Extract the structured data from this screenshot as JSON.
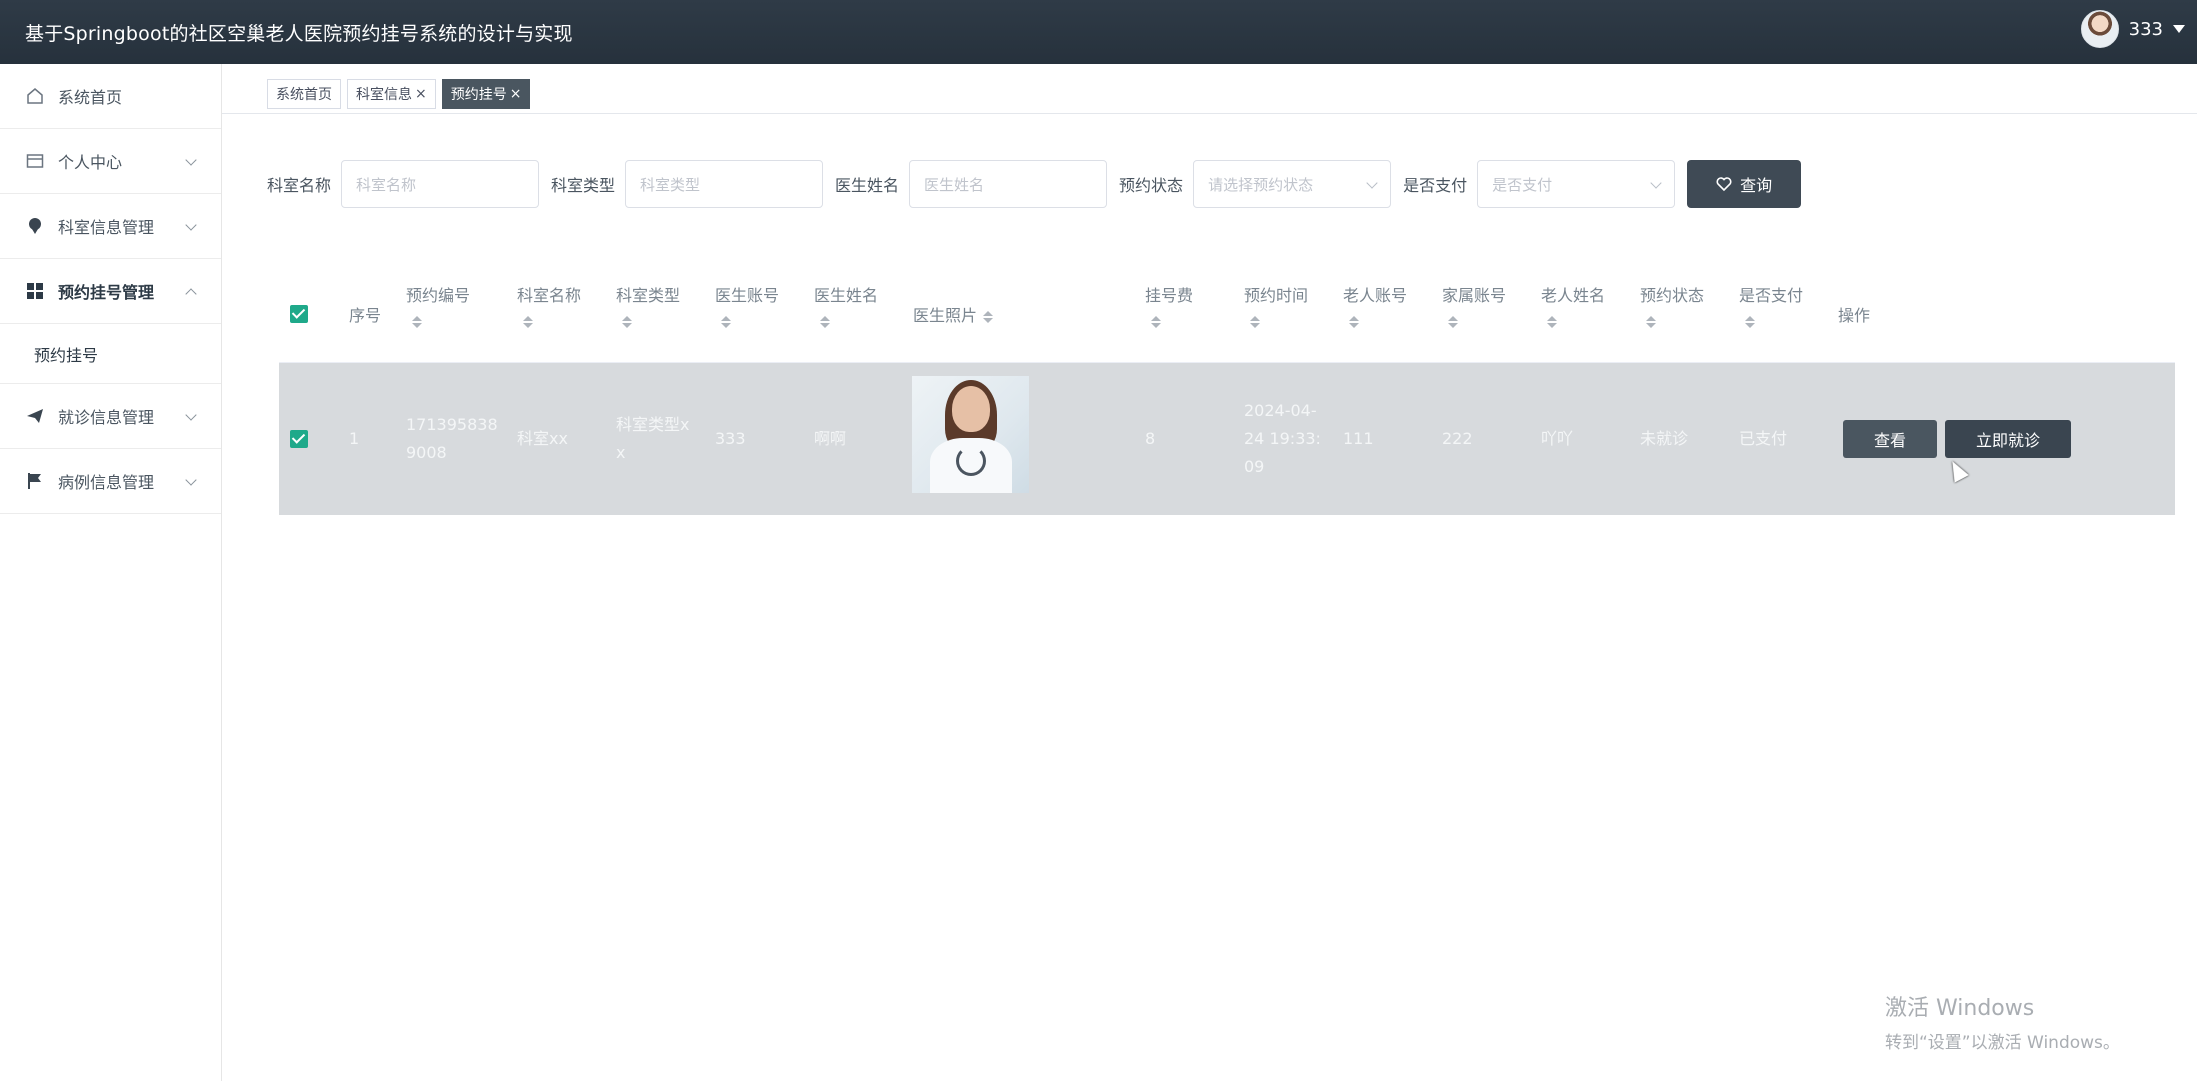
{
  "header": {
    "title": "基于Springboot的社区空巢老人医院预约挂号系统的设计与实现",
    "user_name": "333"
  },
  "sidebar": {
    "items": [
      {
        "label": "系统首页",
        "icon": "home-icon"
      },
      {
        "label": "个人中心",
        "icon": "card-icon"
      },
      {
        "label": "科室信息管理",
        "icon": "pin-icon"
      },
      {
        "label": "预约挂号管理",
        "icon": "grid-icon"
      },
      {
        "label": "就诊信息管理",
        "icon": "send-icon"
      },
      {
        "label": "病例信息管理",
        "icon": "flag-icon"
      }
    ],
    "submenu": {
      "label": "预约挂号"
    }
  },
  "tabs": [
    {
      "label": "系统首页"
    },
    {
      "label": "科室信息",
      "close": "×"
    },
    {
      "label": "预约挂号",
      "close": "×"
    }
  ],
  "search": {
    "dept_name_label": "科室名称",
    "dept_name_placeholder": "科室名称",
    "dept_type_label": "科室类型",
    "dept_type_placeholder": "科室类型",
    "doctor_name_label": "医生姓名",
    "doctor_name_placeholder": "医生姓名",
    "status_label": "预约状态",
    "status_placeholder": "请选择预约状态",
    "paid_label": "是否支付",
    "paid_placeholder": "是否支付",
    "query_button": "查询"
  },
  "table": {
    "columns": [
      "序号",
      "预约编号",
      "科室名称",
      "科室类型",
      "医生账号",
      "医生姓名",
      "医生照片",
      "挂号费",
      "预约时间",
      "老人账号",
      "家属账号",
      "老人姓名",
      "预约状态",
      "是否支付",
      "操作"
    ],
    "rows": [
      {
        "index": "1",
        "booking_no_1": "171395838",
        "booking_no_2": "9008",
        "dept_name": "科室xx",
        "dept_type_1": "科室类型x",
        "dept_type_2": "x",
        "doctor_account": "333",
        "doctor_name": "啊啊",
        "fee": "8",
        "time_1": "2024-04-",
        "time_2": "24 19:33:",
        "time_3": "09",
        "elder_account": "111",
        "family_account": "222",
        "elder_name": "吖吖",
        "status": "未就诊",
        "paid": "已支付",
        "view_button": "查看",
        "visit_button": "立即就诊"
      }
    ]
  },
  "watermark": {
    "line1": "激活 Windows",
    "line2": "转到“设置”以激活 Windows。"
  },
  "colors": {
    "header_bg": "#2b3641",
    "accent_button": "#3f4a55",
    "checkbox": "#1fa98a",
    "selected_row": "#d7dadd"
  }
}
